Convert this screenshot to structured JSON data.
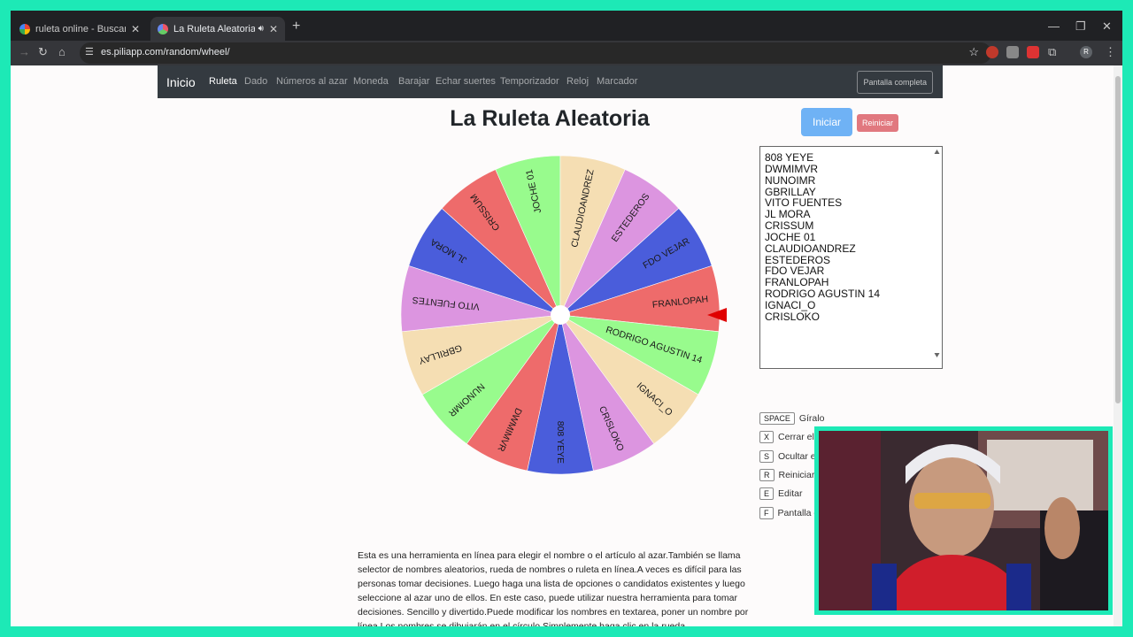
{
  "browser": {
    "tabs": [
      {
        "title": "ruleta online - Buscar con Google",
        "favicon_color": "#ffffff"
      },
      {
        "title": "La Ruleta Aleatoria",
        "favicon_color": "#9aa0a6"
      }
    ],
    "url": "es.piliapp.com/random/wheel/",
    "profile_initial": "R"
  },
  "nav": {
    "brand": "Inicio",
    "links": [
      "Ruleta",
      "Dado",
      "Números al azar",
      "Moneda",
      "Barajar",
      "Echar suertes",
      "Temporizador",
      "Reloj",
      "Marcador"
    ],
    "fullscreen_label": "Pantalla completa"
  },
  "main": {
    "title": "La Ruleta Aleatoria",
    "start_label": "Iniciar",
    "reset_label": "Reiniciar"
  },
  "wheel": {
    "segments": [
      {
        "name": "808 YEYE",
        "color": "#4a5ddb"
      },
      {
        "name": "DWMIMVR",
        "color": "#ee6b6b"
      },
      {
        "name": "NUNOIMR",
        "color": "#98fb8d"
      },
      {
        "name": "GBRILLAY",
        "color": "#f5deb3"
      },
      {
        "name": "VITO FUENTES",
        "color": "#dc95e0"
      },
      {
        "name": "JL MORA",
        "color": "#4a5ddb"
      },
      {
        "name": "CRISSUM",
        "color": "#ee6b6b"
      },
      {
        "name": "JOCHE 01",
        "color": "#98fb8d"
      },
      {
        "name": "CLAUDIOANDREZ",
        "color": "#f5deb3"
      },
      {
        "name": "ESTEDEROS",
        "color": "#dc95e0"
      },
      {
        "name": "FDO VEJAR",
        "color": "#4a5ddb"
      },
      {
        "name": "FRANLOPAH",
        "color": "#ee6b6b"
      },
      {
        "name": "RODRIGO AGUSTIN 14",
        "color": "#98fb8d"
      },
      {
        "name": "IGNACI_O",
        "color": "#f5deb3"
      },
      {
        "name": "CRISLOKO",
        "color": "#dc95e0"
      }
    ],
    "pointer_color": "#e00000"
  },
  "names_list": [
    "808 YEYE",
    "DWMIMVR",
    "NUNOIMR",
    "GBRILLAY",
    "VITO FUENTES",
    "JL MORA",
    "CRISSUM",
    "JOCHE 01",
    "CLAUDIOANDREZ",
    "ESTEDEROS",
    "FDO VEJAR",
    "FRANLOPAH",
    "RODRIGO AGUSTIN 14",
    "IGNACI_O",
    "CRISLOKO"
  ],
  "shortcuts": [
    {
      "key": "SPACE",
      "label": "Gíralo"
    },
    {
      "key": "X",
      "label": "Cerrar el b"
    },
    {
      "key": "S",
      "label": "Ocultar el"
    },
    {
      "key": "R",
      "label": "Reiniciar"
    },
    {
      "key": "E",
      "label": "Editar"
    },
    {
      "key": "F",
      "label": "Pantalla c"
    }
  ],
  "description": "Esta es una herramienta en línea para elegir el nombre o el artículo al azar.También se llama selector de nombres aleatorios, rueda de nombres o ruleta en línea.A veces es difícil para las personas tomar decisiones. Luego haga una lista de opciones o candidatos existentes y luego seleccione al azar uno de ellos. En este caso, puede utilizar nuestra herramienta para tomar decisiones. Sencillo y divertido.Puede modificar los nombres en textarea, poner un nombre por línea.Los nombres se dibujarán en el círculo.Simplemente haga clic en la rueda"
}
